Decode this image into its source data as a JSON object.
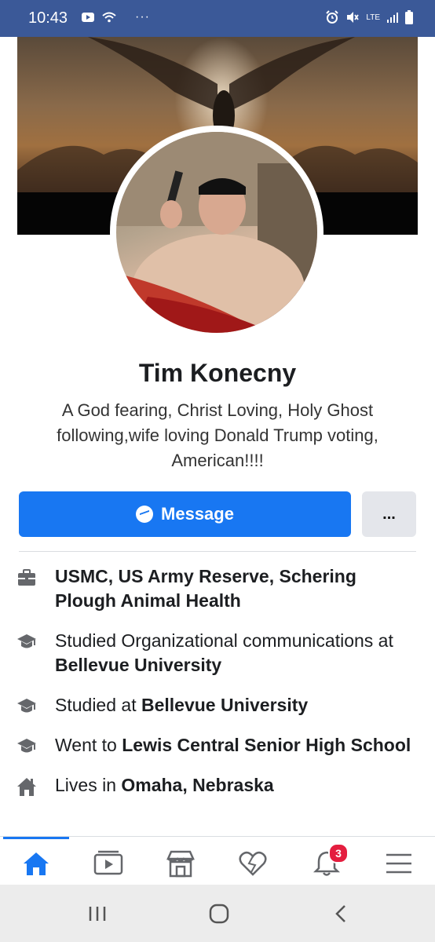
{
  "status_bar": {
    "time": "10:43",
    "network": "LTE"
  },
  "profile": {
    "name": "Tim Konecny",
    "bio": "A God fearing, Christ Loving, Holy Ghost following,wife loving Donald Trump voting, American!!!!"
  },
  "actions": {
    "message_label": "Message",
    "more_label": "..."
  },
  "info": [
    {
      "icon": "briefcase-icon",
      "pre": "",
      "bold": "USMC, US Army Reserve, Schering Plough Animal Health",
      "post": ""
    },
    {
      "icon": "graduation-cap-icon",
      "pre": "Studied Organizational communications at ",
      "bold": "Bellevue University",
      "post": ""
    },
    {
      "icon": "graduation-cap-icon",
      "pre": "Studied at ",
      "bold": "Bellevue University",
      "post": ""
    },
    {
      "icon": "graduation-cap-icon",
      "pre": "Went to ",
      "bold": "Lewis Central Senior High School",
      "post": ""
    },
    {
      "icon": "house-icon",
      "pre": "Lives in ",
      "bold": "Omaha, Nebraska",
      "post": ""
    }
  ],
  "bottom_nav": {
    "items": [
      "home-icon",
      "watch-icon",
      "marketplace-icon",
      "dating-icon",
      "notifications-icon",
      "menu-icon"
    ],
    "notifications_badge": "3"
  },
  "colors": {
    "status_bar": "#3b5998",
    "accent": "#1877f2",
    "badge": "#e41e3f"
  }
}
